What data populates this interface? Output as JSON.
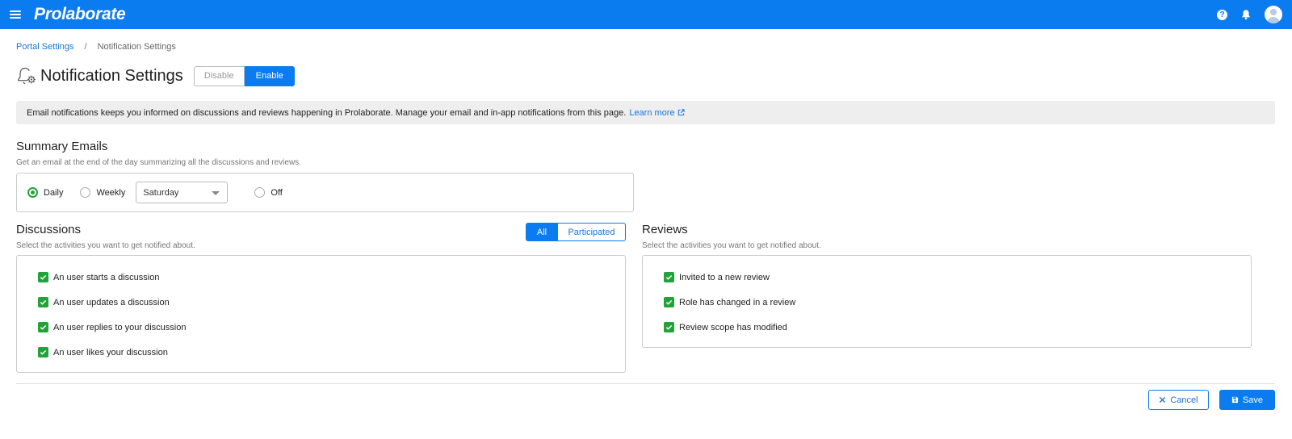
{
  "header": {
    "brand": "Prolaborate",
    "icons": [
      "menu-icon",
      "help-icon",
      "bell-icon",
      "user-avatar"
    ]
  },
  "breadcrumb": {
    "parent": "Portal Settings",
    "separator": "/",
    "current": "Notification Settings"
  },
  "page": {
    "title": "Notification Settings",
    "title_icon": "bell-gear-icon",
    "toggle": {
      "disable_label": "Disable",
      "enable_label": "Enable",
      "selected": "Enable"
    }
  },
  "info": {
    "text": "Email notifications keeps you informed on discussions and reviews happening in Prolaborate. Manage your email and in-app notifications from this page.",
    "link_label": "Learn more"
  },
  "summary": {
    "title": "Summary Emails",
    "subtitle": "Get an email at the end of the day summarizing all the discussions and reviews.",
    "options": {
      "daily": "Daily",
      "weekly": "Weekly",
      "off": "Off"
    },
    "selected": "Daily",
    "weekday_value": "Saturday"
  },
  "discussions": {
    "title": "Discussions",
    "subtitle": "Select the activities you want to get notified about.",
    "filter": {
      "all": "All",
      "participated": "Participated",
      "selected": "All"
    },
    "items": [
      "An user starts a discussion",
      "An user updates a discussion",
      "An user replies to your discussion",
      "An user likes your discussion"
    ]
  },
  "reviews": {
    "title": "Reviews",
    "subtitle": "Select the activities you want to get notified about.",
    "items": [
      "Invited to a new review",
      "Role has changed in a review",
      "Review scope has modified"
    ]
  },
  "footer": {
    "cancel_label": "Cancel",
    "save_label": "Save"
  },
  "colors": {
    "primary": "#0a7cf0",
    "check_green": "#22a33a",
    "banner_bg": "#eeeeee"
  }
}
